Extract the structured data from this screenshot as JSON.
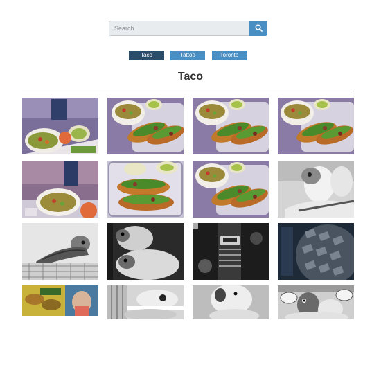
{
  "search": {
    "placeholder": "Search"
  },
  "categories": [
    {
      "label": "Taco",
      "active": true
    },
    {
      "label": "Tattoo",
      "active": false
    },
    {
      "label": "Toronto",
      "active": false
    }
  ],
  "page_title": "Taco",
  "colors": {
    "accent": "#4a8fc4",
    "active": "#2a4d6b",
    "title": "#333333"
  },
  "images": [
    {
      "subject": "taco-soup-plate"
    },
    {
      "subject": "tacos-with-soup"
    },
    {
      "subject": "tacos-with-soup"
    },
    {
      "subject": "tacos-with-soup"
    },
    {
      "subject": "soup-bowl-drink"
    },
    {
      "subject": "tacos-in-tray"
    },
    {
      "subject": "tacos-with-soup"
    },
    {
      "subject": "parrots-grayscale"
    },
    {
      "subject": "parrot-on-cage"
    },
    {
      "subject": "two-parrots"
    },
    {
      "subject": "motorcycle-shock-absorber"
    },
    {
      "subject": "tire-tread"
    },
    {
      "subject": "collage-taco-photos"
    },
    {
      "subject": "parrot-cage-closeup"
    },
    {
      "subject": "parrot-closeup"
    },
    {
      "subject": "parrot-with-cups"
    }
  ]
}
